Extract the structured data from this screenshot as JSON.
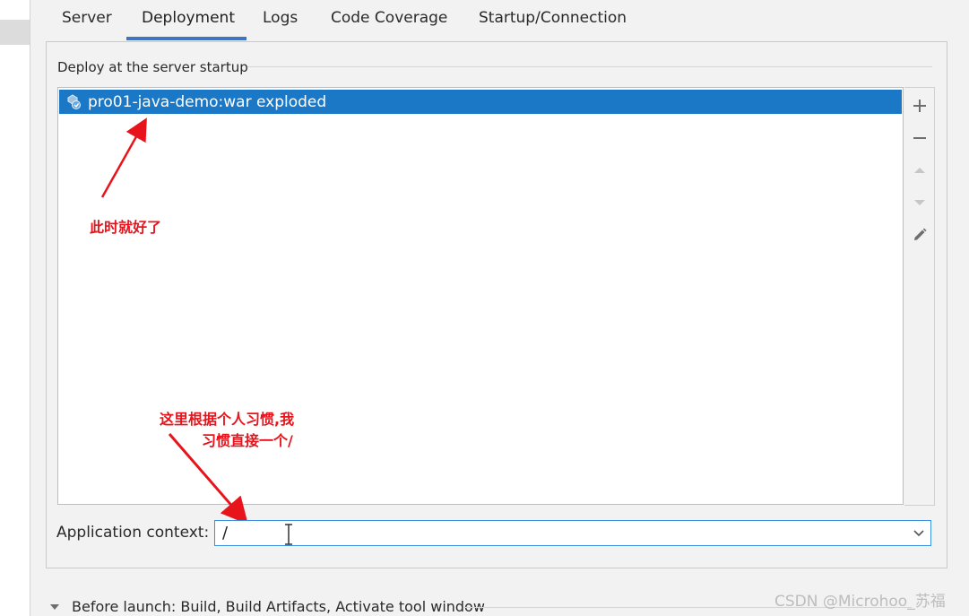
{
  "tabs": [
    {
      "label": "Server"
    },
    {
      "label": "Deployment"
    },
    {
      "label": "Logs"
    },
    {
      "label": "Code Coverage"
    },
    {
      "label": "Startup/Connection"
    }
  ],
  "active_tab": "Deployment",
  "deploy": {
    "group_label": "Deploy at the server startup",
    "items": [
      {
        "label": "pro01-java-demo:war exploded",
        "icon": "artifact-icon",
        "selected": true
      }
    ]
  },
  "toolbar": {
    "add_icon": "plus-icon",
    "remove_icon": "minus-icon",
    "up_icon": "move-up-icon",
    "down_icon": "move-down-icon",
    "edit_icon": "pencil-icon"
  },
  "annotations": {
    "note1": "此时就好了",
    "note2_line1": "这里根据个人习惯,我",
    "note2_line2": "习惯直接一个/"
  },
  "app_context": {
    "label": "Application context:",
    "value": "/"
  },
  "before_launch": {
    "label": "Before launch: Build, Build Artifacts, Activate tool window"
  },
  "watermark": "CSDN @Microhoo_苏福",
  "colors": {
    "accent": "#3d75c2",
    "selection": "#1a78c7",
    "annotation": "#e8141c",
    "focus_border": "#3d8fe0"
  }
}
